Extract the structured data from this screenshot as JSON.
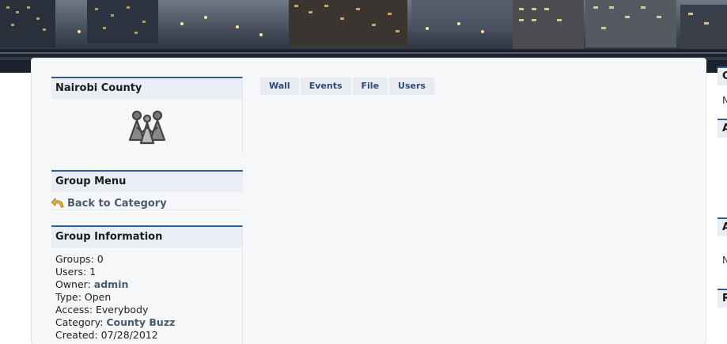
{
  "banner": {
    "icon": "city-skyline-image"
  },
  "county_box": {
    "title": "Nairobi County",
    "logo_icon": "group-people-icon"
  },
  "menu_box": {
    "title": "Group Menu",
    "back_label": "Back to Category",
    "back_icon": "return-arrow-icon"
  },
  "info_box": {
    "title": "Group Information",
    "groups": "Groups: 0",
    "users": "Users: 1",
    "owner_label": "Owner: ",
    "owner_value": "admin",
    "type": "Type: Open",
    "access": "Access: Everybody",
    "category_label": "Category: ",
    "category_value": "County Buzz",
    "created": "Created: 07/28/2012"
  },
  "tabs": [
    {
      "label": "Wall"
    },
    {
      "label": "Events"
    },
    {
      "label": "File"
    },
    {
      "label": "Users"
    }
  ],
  "right_edge": {
    "box1": "C",
    "text1": "N",
    "box2": "A",
    "box3": "A",
    "text3": "N",
    "box4": "R"
  },
  "colors": {
    "accent": "#2c5f98",
    "link": "#4a5b6e",
    "tab_text": "#2e4a75",
    "header_bg": "#eaedf3"
  }
}
